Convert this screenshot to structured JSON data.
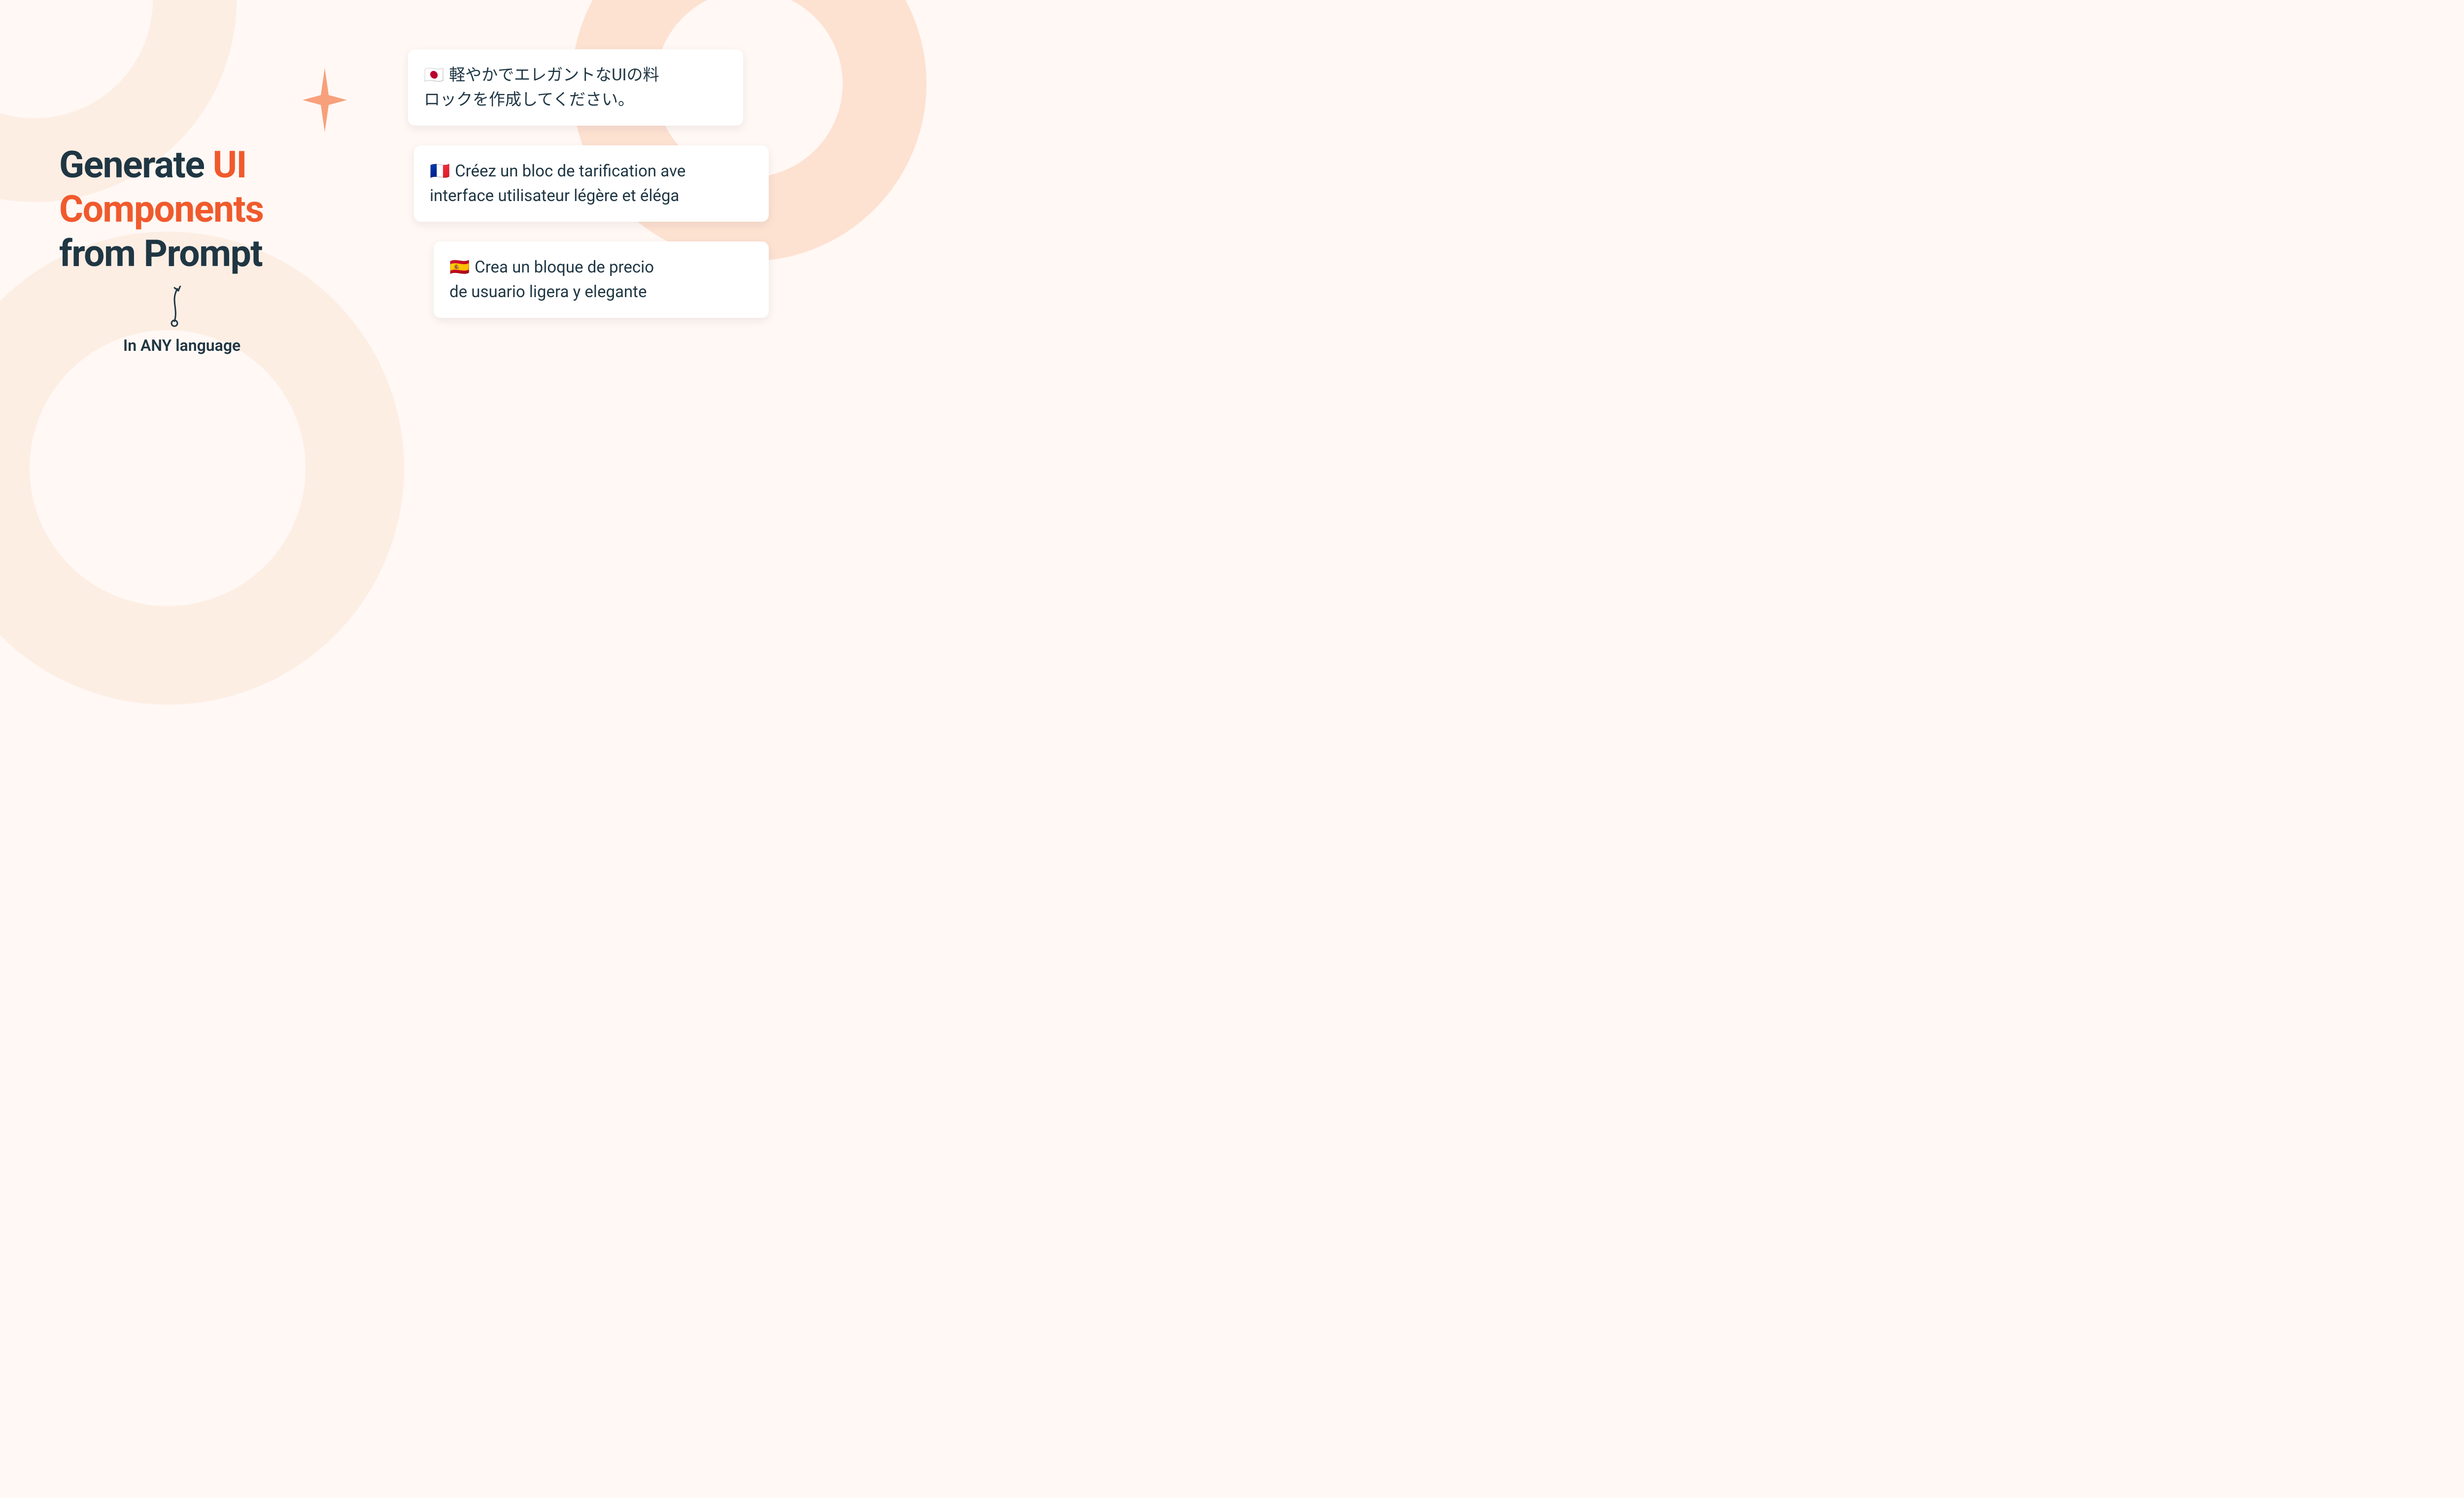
{
  "headline": {
    "line1_prefix": "Generate ",
    "line1_accent": "UI",
    "line2_accent": "Components",
    "line3": "from Prompt"
  },
  "subtitle": "In ANY language",
  "icons": {
    "sparkle": "sparkle-icon",
    "arrow": "curved-arrow-icon"
  },
  "cards": [
    {
      "id": "jp",
      "flag": "🇯🇵",
      "text": "軽やかでエレガントなUIの料\nロックを作成してください。"
    },
    {
      "id": "fr",
      "flag": "🇫🇷",
      "text": "Créez un bloc de tarification ave\ninterface utilisateur légère et éléga"
    },
    {
      "id": "es",
      "flag": "🇪🇸",
      "text": "Crea un bloque de precio\nde usuario ligera y elegante"
    }
  ],
  "colors": {
    "accent": "#f05a2d",
    "ink": "#1f3643",
    "bg": "#fff8f4",
    "ringLight": "#fdeee4",
    "ringMed": "#fde1d1"
  }
}
